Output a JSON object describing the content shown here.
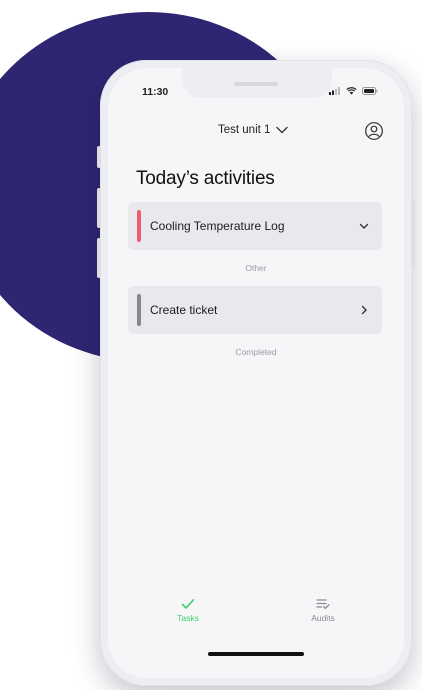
{
  "status_bar": {
    "time": "11:30",
    "icons": [
      "signal-icon",
      "wifi-icon",
      "battery-icon"
    ]
  },
  "header": {
    "unit_name": "Test unit 1",
    "icons": [
      "chevron-down-icon",
      "profile-icon"
    ]
  },
  "page": {
    "title": "Today’s activities"
  },
  "activities": [
    {
      "label": "Cooling Temperature Log",
      "status_color": "#e8606f",
      "icon": "chevron-down-icon"
    }
  ],
  "sections": {
    "other_label": "Other",
    "completed_label": "Completed"
  },
  "other_items": [
    {
      "label": "Create ticket",
      "status_color": "#88878d",
      "icon": "chevron-right-icon"
    }
  ],
  "bottom_nav": {
    "tabs": [
      {
        "label": "Tasks",
        "icon": "check-icon",
        "active": true
      },
      {
        "label": "Audits",
        "icon": "audits-list-icon",
        "active": false
      }
    ],
    "active_color": "#3ecf6a",
    "inactive_color": "#8c8c92"
  },
  "colors": {
    "accent_blob": "#2e2672",
    "screen_bg": "#f6f6f8",
    "card_bg": "#e9e9ed"
  }
}
